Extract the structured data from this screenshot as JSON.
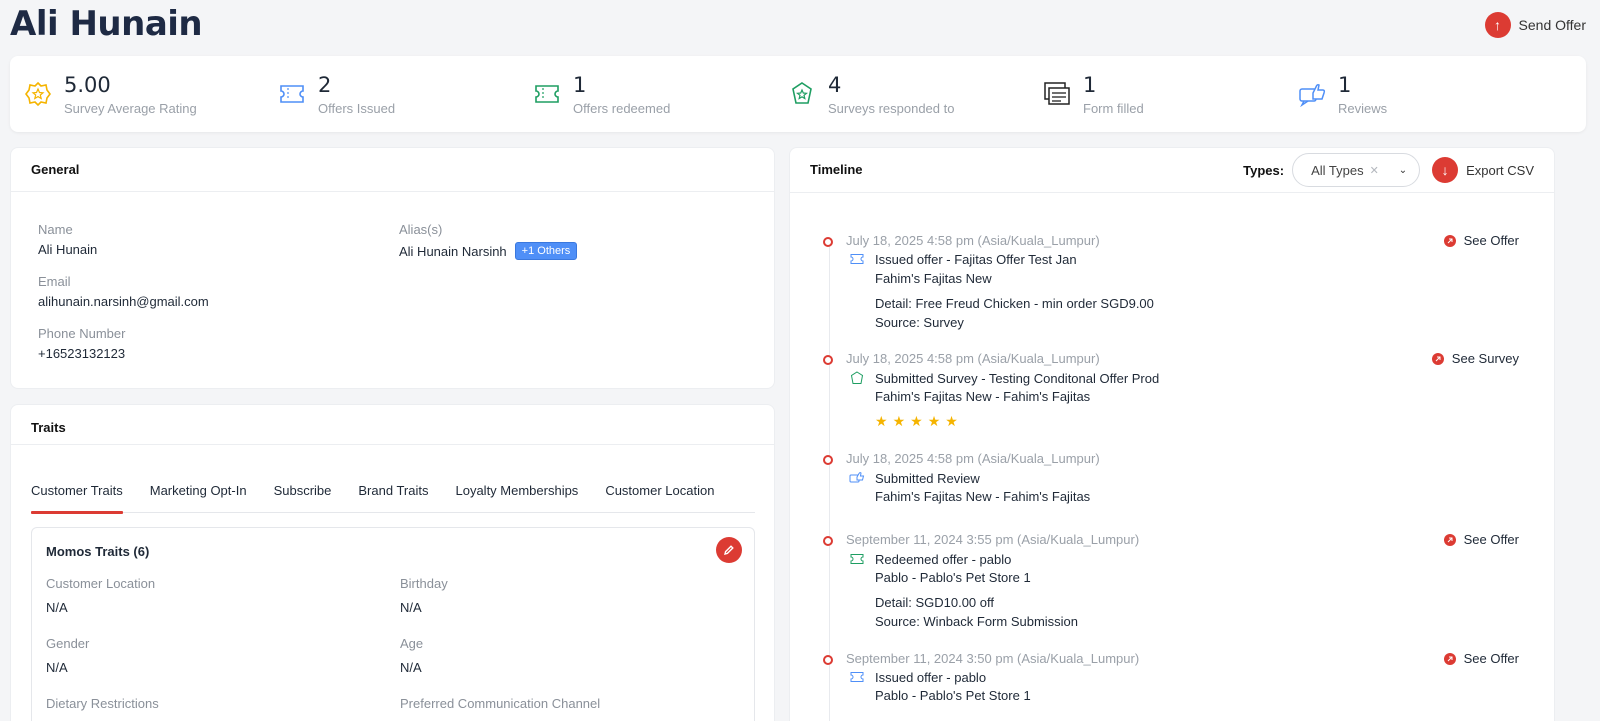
{
  "header": {
    "title": "Ali Hunain",
    "send_offer_label": "Send Offer"
  },
  "stats": [
    {
      "value": "5.00",
      "label": "Survey Average Rating",
      "icon": "star-badge-icon",
      "color": "#f5b400"
    },
    {
      "value": "2",
      "label": "Offers Issued",
      "icon": "ticket-icon",
      "color": "#4f8ff7"
    },
    {
      "value": "1",
      "label": "Offers redeemed",
      "icon": "ticket-check-icon",
      "color": "#1e9e62"
    },
    {
      "value": "4",
      "label": "Surveys responded to",
      "icon": "survey-badge-icon",
      "color": "#1e9e62"
    },
    {
      "value": "1",
      "label": "Form filled",
      "icon": "form-icon",
      "color": "#222222"
    },
    {
      "value": "1",
      "label": "Reviews",
      "icon": "thumbs-up-icon",
      "color": "#4f8ff7"
    }
  ],
  "general": {
    "title": "General",
    "name_label": "Name",
    "name": "Ali Hunain",
    "alias_label": "Alias(s)",
    "alias": "Ali Hunain Narsinh",
    "alias_badge": "+1 Others",
    "email_label": "Email",
    "email": "alihunain.narsinh@gmail.com",
    "phone_label": "Phone Number",
    "phone": "+16523132123"
  },
  "traits": {
    "title": "Traits",
    "tabs": [
      "Customer Traits",
      "Marketing Opt-In",
      "Subscribe",
      "Brand Traits",
      "Loyalty Memberships",
      "Customer Location"
    ],
    "active_tab": "Customer Traits",
    "card_title": "Momos Traits (6)",
    "fields": [
      {
        "label": "Customer Location",
        "value": "N/A"
      },
      {
        "label": "Birthday",
        "value": "N/A"
      },
      {
        "label": "Gender",
        "value": "N/A"
      },
      {
        "label": "Age",
        "value": "N/A"
      },
      {
        "label": "Dietary Restrictions",
        "value": ""
      },
      {
        "label": "Preferred Communication Channel",
        "value": ""
      }
    ]
  },
  "timeline": {
    "title": "Timeline",
    "types_label": "Types:",
    "types_value": "All Types",
    "export_label": "Export CSV",
    "events": [
      {
        "date": "July 18, 2025 4:58 pm (Asia/Kuala_Lumpur)",
        "icon": "ticket-icon",
        "title": "Issued offer - Fajitas Offer Test Jan",
        "subtitle": "Fahim's Fajitas New",
        "detail": "Detail: Free Freud Chicken - min order SGD9.00",
        "source": "Source: Survey",
        "action": "See Offer"
      },
      {
        "date": "July 18, 2025 4:58 pm (Asia/Kuala_Lumpur)",
        "icon": "survey-badge-icon",
        "title": "Submitted Survey - Testing Conditonal Offer Prod",
        "subtitle": "Fahim's Fajitas New - Fahim's Fajitas",
        "rating": 5,
        "action": "See Survey"
      },
      {
        "date": "July 18, 2025 4:58 pm (Asia/Kuala_Lumpur)",
        "icon": "thumbs-up-icon",
        "title": "Submitted Review",
        "subtitle": "Fahim's Fajitas New - Fahim's Fajitas"
      },
      {
        "date": "September 11, 2024 3:55 pm (Asia/Kuala_Lumpur)",
        "icon": "ticket-check-icon",
        "title": "Redeemed offer - pablo",
        "subtitle": "Pablo - Pablo's Pet Store 1",
        "detail": "Detail: SGD10.00 off",
        "source": "Source: Winback Form Submission",
        "action": "See Offer"
      },
      {
        "date": "September 11, 2024 3:50 pm (Asia/Kuala_Lumpur)",
        "icon": "ticket-icon",
        "title": "Issued offer - pablo",
        "subtitle": "Pablo - Pablo's Pet Store 1",
        "action": "See Offer"
      }
    ]
  }
}
